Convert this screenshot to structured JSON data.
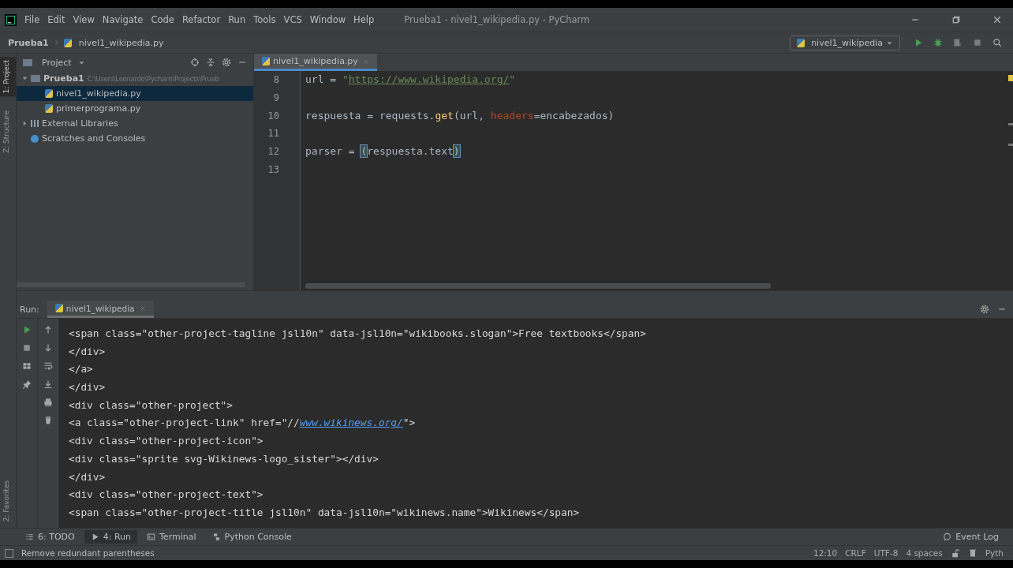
{
  "menu_bar": {
    "items": [
      "File",
      "Edit",
      "View",
      "Navigate",
      "Code",
      "Refactor",
      "Run",
      "Tools",
      "VCS",
      "Window",
      "Help"
    ],
    "title": "Prueba1 - nivel1_wikipedia.py - PyCharm"
  },
  "nav_bar": {
    "breadcrumbs": [
      "Prueba1",
      "nivel1_wikipedia.py"
    ],
    "run_config": "nivel1_wikipedia"
  },
  "left_strip": {
    "top": [
      {
        "label": "1: Project",
        "selected": true
      },
      {
        "label": "Z: Structure",
        "selected": false
      }
    ],
    "bottom": [
      {
        "label": "2: Favorites",
        "selected": false
      }
    ]
  },
  "project_panel": {
    "title": "Project",
    "tree": [
      {
        "label": "Prueba1",
        "path": "C:\\Users\\Leonardo\\PycharmProjects\\Prueb",
        "kind": "folder",
        "expanded": true,
        "selected": false,
        "children": [
          {
            "label": "nivel1_wikipedia.py",
            "kind": "file",
            "selected": true
          },
          {
            "label": "primerprograma.py",
            "kind": "file",
            "selected": false
          }
        ]
      },
      {
        "label": "External Libraries",
        "kind": "library",
        "expanded": false,
        "selected": false
      },
      {
        "label": "Scratches and Consoles",
        "kind": "scratch",
        "selected": false
      }
    ]
  },
  "editor": {
    "tabs": [
      {
        "label": "nivel1_wikipedia.py",
        "selected": true
      }
    ],
    "lines": [
      {
        "number": "8",
        "tokens": [
          {
            "text": "url ",
            "kind": "plain"
          },
          {
            "text": "=",
            "kind": "op"
          },
          {
            "text": " \"",
            "kind": "string"
          },
          {
            "text": "https://www.wikipedia.org/",
            "kind": "link"
          },
          {
            "text": "\"",
            "kind": "string"
          }
        ]
      },
      {
        "number": "9"
      },
      {
        "number": "10",
        "tokens": [
          {
            "text": "respuesta ",
            "kind": "plain"
          },
          {
            "text": "=",
            "kind": "op"
          },
          {
            "text": " requests.",
            "kind": "plain"
          },
          {
            "text": "get",
            "kind": "func"
          },
          {
            "text": "(url, ",
            "kind": "plain"
          },
          {
            "text": "headers",
            "kind": "param"
          },
          {
            "text": "=",
            "kind": "op"
          },
          {
            "text": "encabezados)",
            "kind": "plain"
          }
        ]
      },
      {
        "number": "11"
      },
      {
        "number": "12",
        "tokens": [
          {
            "text": "parser ",
            "kind": "plain"
          },
          {
            "text": "= ",
            "kind": "op"
          },
          {
            "text": "(",
            "kind": "match"
          },
          {
            "text": "respuesta.text",
            "kind": "plain"
          },
          {
            "text": ")",
            "kind": "match"
          }
        ]
      },
      {
        "number": "13"
      }
    ]
  },
  "run_panel": {
    "label": "Run:",
    "tabs": [
      {
        "label": "nivel1_wikipedia",
        "selected": true
      }
    ],
    "console": [
      [
        {
          "text": "<span class=\"other-project-tagline jsl10n\" data-jsl10n=\"wikibooks.slogan\">Free textbooks</span>",
          "kind": "plain"
        }
      ],
      [
        {
          "text": "</div>",
          "kind": "plain"
        }
      ],
      [
        {
          "text": "</a>",
          "kind": "plain"
        }
      ],
      [
        {
          "text": "</div>",
          "kind": "plain"
        }
      ],
      [
        {
          "text": "<div class=\"other-project\">",
          "kind": "plain"
        }
      ],
      [
        {
          "text": "<a class=\"other-project-link\" href=\"//",
          "kind": "plain"
        },
        {
          "text": "www.wikinews.org/",
          "kind": "link"
        },
        {
          "text": "\">",
          "kind": "plain"
        }
      ],
      [
        {
          "text": "<div class=\"other-project-icon\">",
          "kind": "plain"
        }
      ],
      [
        {
          "text": "<div class=\"sprite svg-Wikinews-logo_sister\"></div>",
          "kind": "plain"
        }
      ],
      [
        {
          "text": "</div>",
          "kind": "plain"
        }
      ],
      [
        {
          "text": "<div class=\"other-project-text\">",
          "kind": "plain"
        }
      ],
      [
        {
          "text": "<span class=\"other-project-title jsl10n\" data-jsl10n=\"wikinews.name\">Wikinews</span>",
          "kind": "plain"
        }
      ]
    ]
  },
  "tool_tabs": [
    {
      "label": "6: TODO",
      "kind": "todo",
      "selected": false
    },
    {
      "label": "4: Run",
      "kind": "run",
      "selected": true
    },
    {
      "label": "Terminal",
      "kind": "terminal",
      "selected": false
    },
    {
      "label": "Python Console",
      "kind": "python",
      "selected": false
    }
  ],
  "event_log": "Event Log",
  "status_bar": {
    "message": "Remove redundant parentheses",
    "items": [
      "12:10",
      "CRLF",
      "UTF-8",
      "4 spaces"
    ],
    "interpreter": "Pyth"
  }
}
